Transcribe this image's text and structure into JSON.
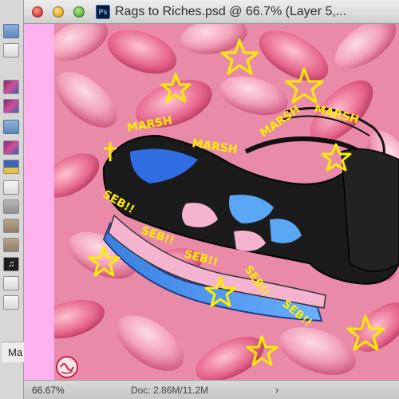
{
  "window": {
    "title": "Rags to Riches.psd @ 66.7% (Layer 5,...",
    "app_icon_label": "Ps"
  },
  "left_strip": {
    "partial_window_text": "Ma",
    "icons": [
      "folder-icon",
      "document-icon",
      "image-icon",
      "image-icon",
      "folder-icon",
      "image-icon",
      "image-icon",
      "document-icon",
      "document-icon",
      "image-icon",
      "image-icon",
      "music-icon",
      "document-icon",
      "document-icon"
    ]
  },
  "canvas": {
    "background_color": "#ffb2ee",
    "doodle_color": "#ffee00",
    "handwritten_labels": [
      "MARSH",
      "MARSH",
      "MARSH",
      "MARSH",
      "SEB!!",
      "SEB!!",
      "SEB!!",
      "SEB!!",
      "SEB!!"
    ]
  },
  "statusbar": {
    "zoom": "66.67%",
    "doc_size": "Doc: 2.86M/11.2M"
  }
}
